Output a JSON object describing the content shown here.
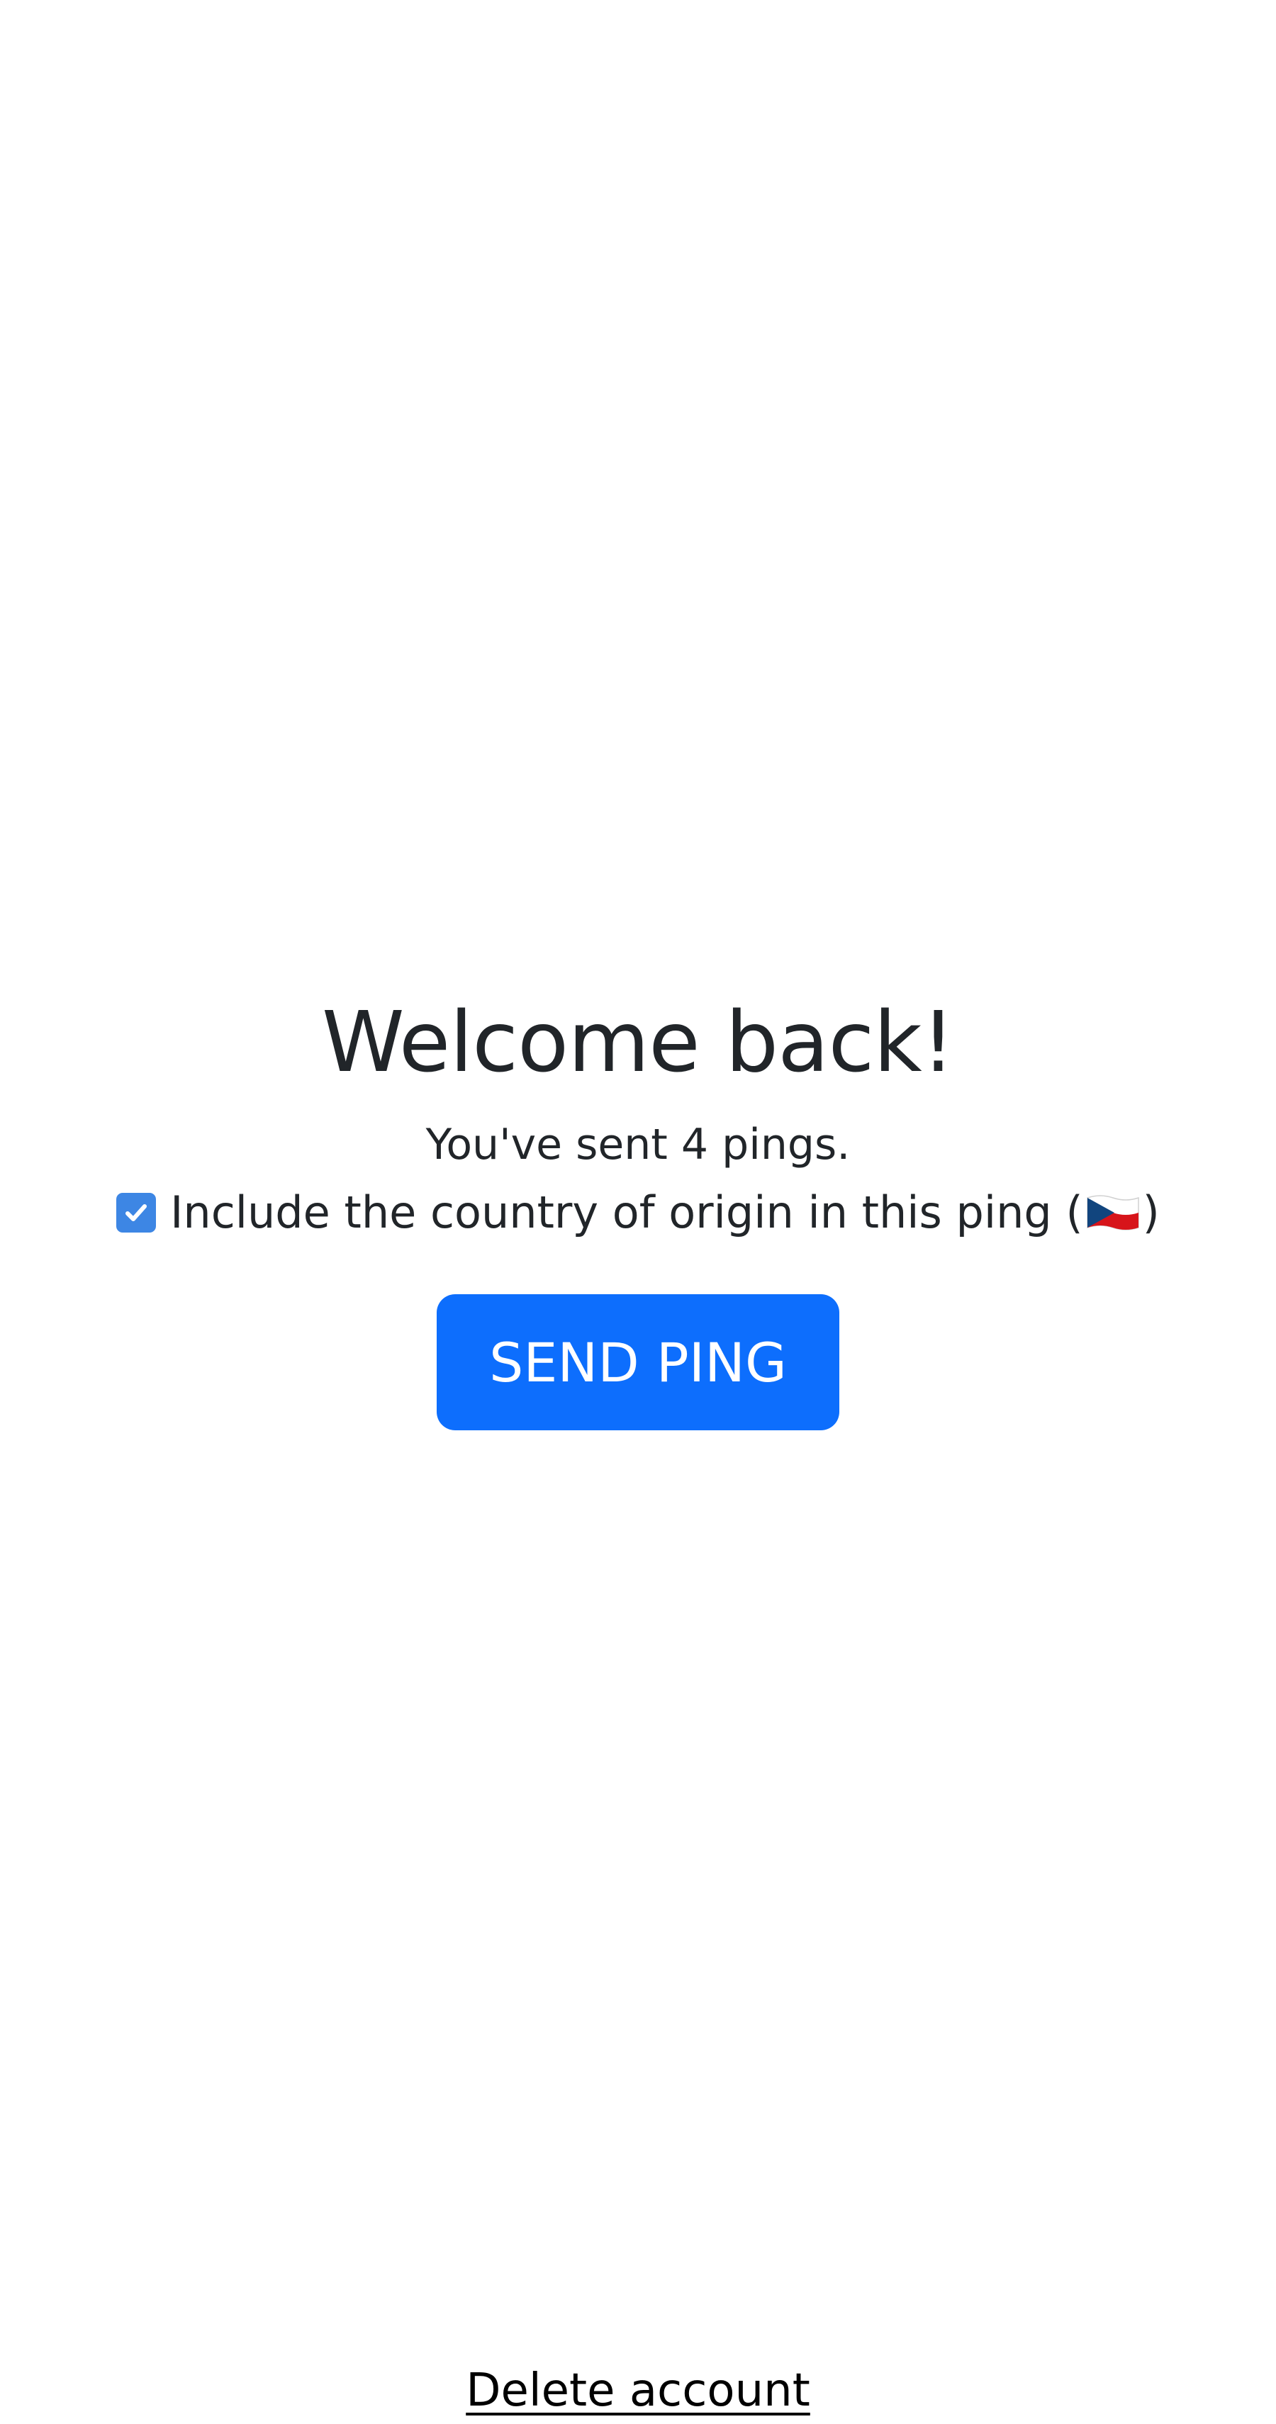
{
  "main": {
    "title": "Welcome back!",
    "sent_prefix": "You've sent ",
    "ping_count": "4",
    "sent_suffix": " pings.",
    "origin_checkbox": {
      "checked": true,
      "label": "Include the country of origin in this ping (",
      "label_close": ")",
      "flag_icon": "czech-flag-icon"
    },
    "send_button_label": "SEND PING"
  },
  "footer": {
    "delete_account_label": "Delete account"
  },
  "colors": {
    "button": "#0d6efd",
    "checkbox": "#3d86e4",
    "text": "#212529"
  }
}
